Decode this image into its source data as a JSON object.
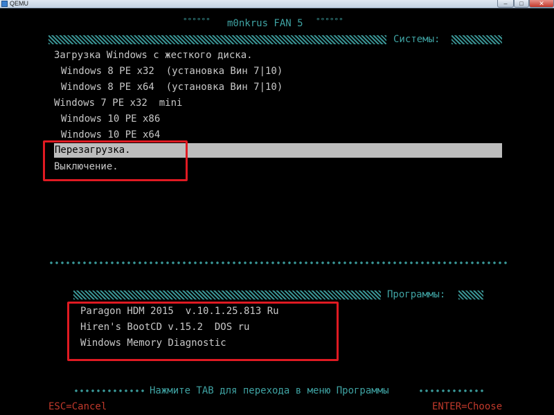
{
  "window": {
    "title": "QEMU",
    "min_glyph": "–",
    "max_glyph": "□",
    "close_glyph": "✕"
  },
  "header": {
    "title": "m0nkrus FAN 5",
    "deco_left": "°°°°°°",
    "deco_right": "°°°°°°"
  },
  "systems": {
    "label": "Системы:",
    "items": [
      "Загрузка Windows с жесткого диска.",
      "Windows 8 PE x32  (установка Вин 7|10)",
      "Windows 8 PE x64  (установка Вин 7|10)",
      "Windows 7 PE x32  mini",
      "Windows 10 PE x86",
      "Windows 10 PE x64",
      "Перезагрузка.",
      "Выключение."
    ],
    "selected_index": 6
  },
  "programs": {
    "label": "Программы:",
    "items": [
      "Paragon HDM 2015  v.10.1.25.813 Ru",
      "Hiren's BootCD v.15.2  DOS ru",
      "Windows Memory Diagnostic"
    ]
  },
  "footer": {
    "hint": "Нажмите TAB для перехода в меню Программы",
    "esc": "ESC=Cancel",
    "enter": "ENTER=Choose"
  },
  "colors": {
    "text": "#c8c8c8",
    "accent": "#3fa3a3",
    "selection": "#bdbdbd",
    "annotation": "#e01a22",
    "footer_keys": "#c0392b"
  }
}
